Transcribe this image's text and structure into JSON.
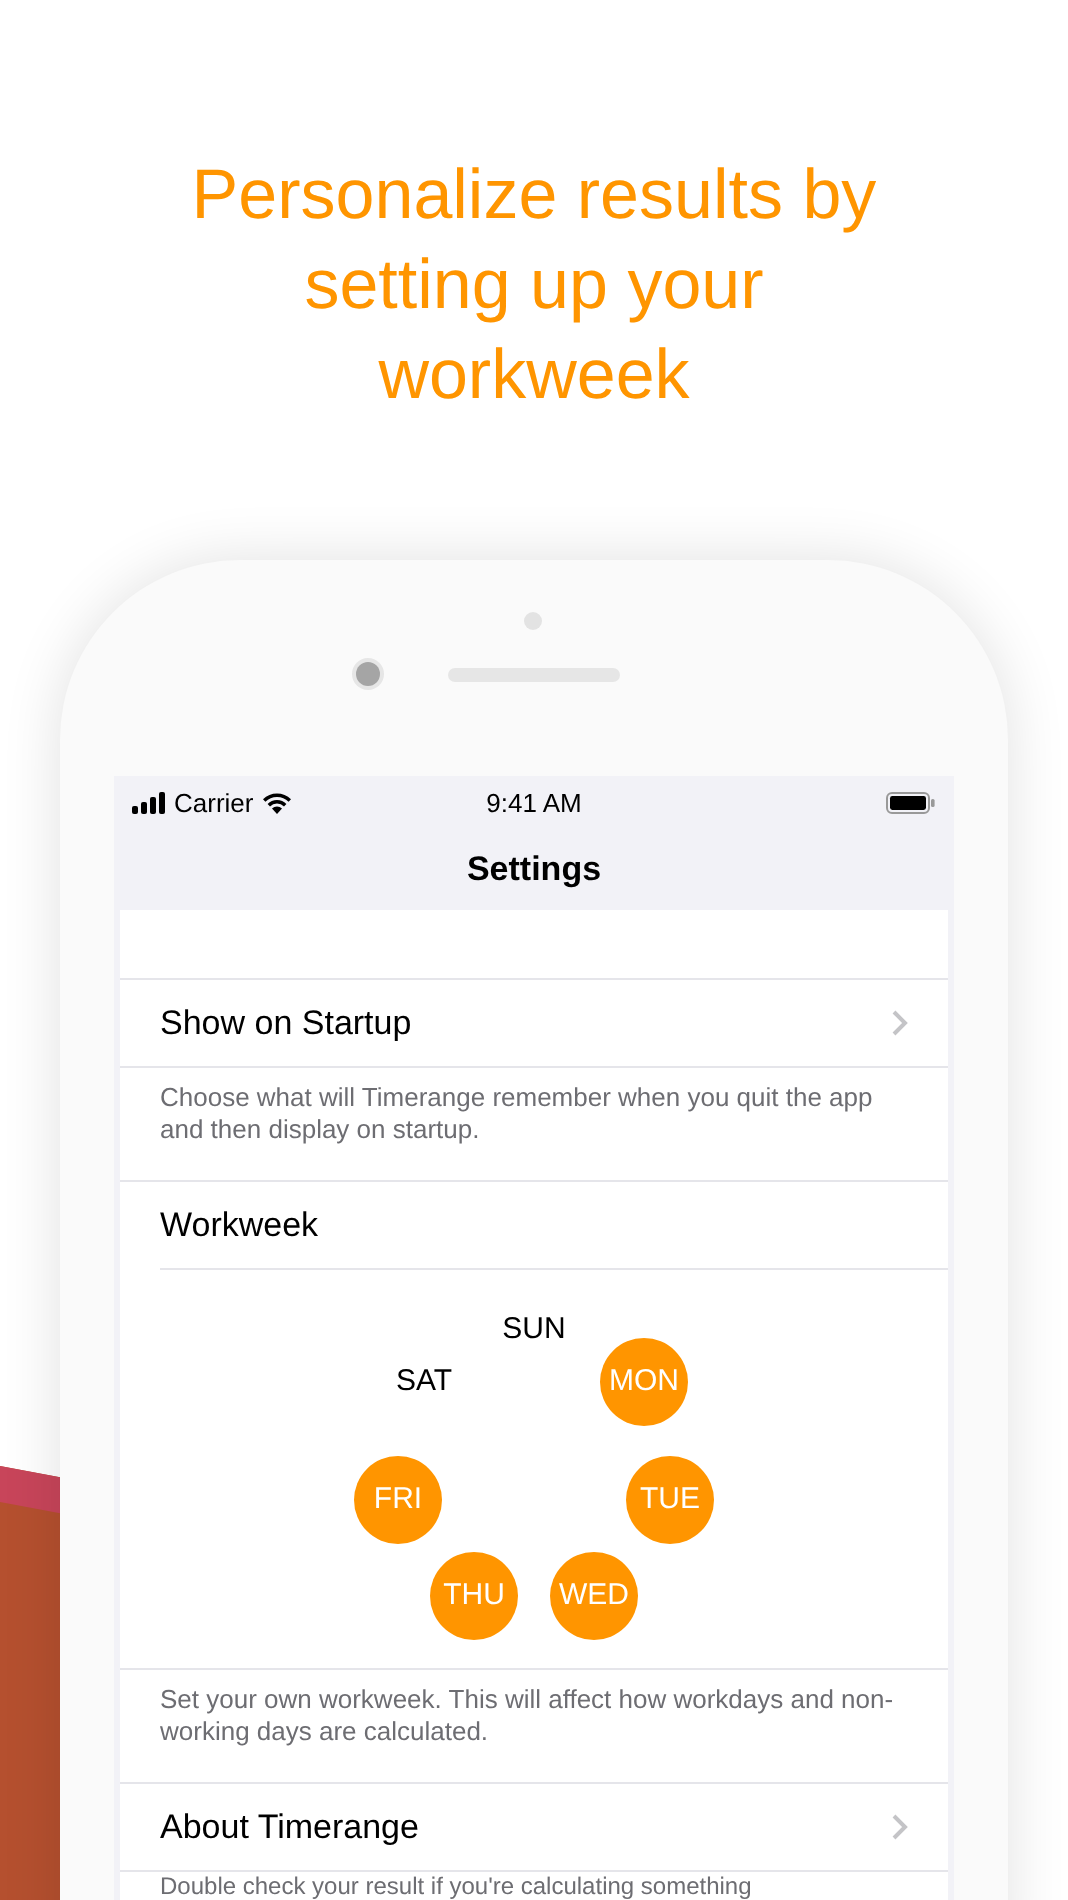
{
  "headline": "Personalize results by setting up your workweek",
  "status_bar": {
    "carrier": "Carrier",
    "time": "9:41 AM"
  },
  "nav": {
    "title": "Settings"
  },
  "startup": {
    "label": "Show on Startup",
    "footer": "Choose what will Timerange remember when you quit the app and then display on startup."
  },
  "workweek": {
    "label": "Workweek",
    "days": [
      {
        "label": "SUN",
        "selected": false
      },
      {
        "label": "MON",
        "selected": true
      },
      {
        "label": "TUE",
        "selected": true
      },
      {
        "label": "WED",
        "selected": true
      },
      {
        "label": "THU",
        "selected": true
      },
      {
        "label": "FRI",
        "selected": true
      },
      {
        "label": "SAT",
        "selected": false
      }
    ],
    "footer": "Set your own workweek. This will affect how workdays and non-working days are calculated."
  },
  "about": {
    "label": "About Timerange",
    "footer": "Double check your result if you're calculating something"
  }
}
